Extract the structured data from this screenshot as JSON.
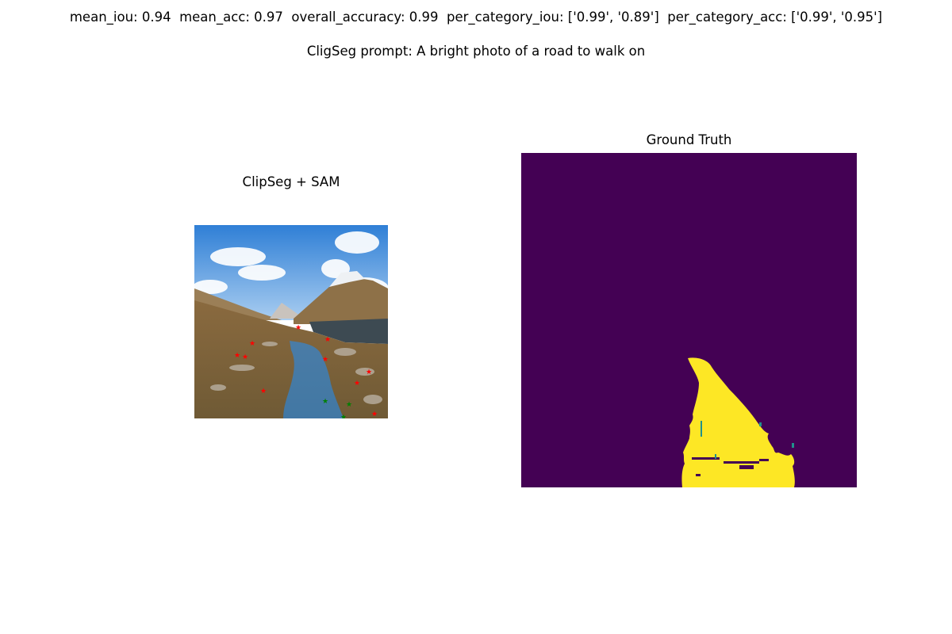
{
  "metrics_line": "mean_iou: 0.94  mean_acc: 0.97  overall_accuracy: 0.99  per_category_iou: ['0.99', '0.89']  per_category_acc: ['0.99', '0.95']",
  "prompt_line": "CligSeg prompt: A bright photo of a road to walk on",
  "left_panel": {
    "title": "ClipSeg + SAM"
  },
  "right_panel": {
    "title": "Ground Truth"
  },
  "colors": {
    "mask_background": "#440154",
    "mask_foreground": "#fde725",
    "mask_edge": "#21918c",
    "sam_mask_overlay": "#1e90ff",
    "negative_point": "#ff0000",
    "positive_point": "#008000"
  }
}
